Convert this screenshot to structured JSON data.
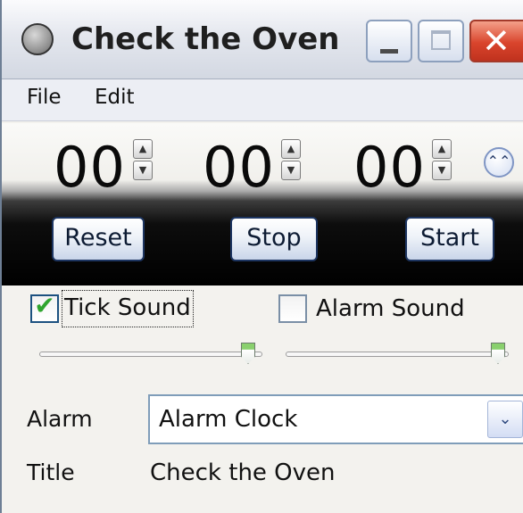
{
  "window": {
    "title": "Check the Oven",
    "icon": "clock-icon",
    "close_glyph": "✕"
  },
  "menu": {
    "items": [
      "File",
      "Edit"
    ]
  },
  "timer": {
    "hours": "00",
    "minutes": "00",
    "seconds": "00",
    "spin_up_glyph": "▲",
    "spin_down_glyph": "▼",
    "collapse_glyph": "⌃⌃"
  },
  "controls": {
    "reset_label": "Reset",
    "stop_label": "Stop",
    "start_label": "Start"
  },
  "sound": {
    "tick_label": "Tick Sound",
    "tick_checked": true,
    "tick_volume": 1.0,
    "alarm_label": "Alarm Sound",
    "alarm_checked": false,
    "alarm_volume": 1.0,
    "check_glyph": "✔"
  },
  "alarm": {
    "label": "Alarm",
    "value": "Alarm Clock",
    "dropdown_glyph": "⌄"
  },
  "title_row": {
    "label": "Title",
    "value": "Check the Oven"
  },
  "colors": {
    "accent_green": "#2fa52f",
    "close_red": "#d9442c",
    "button_border": "#1d3561"
  }
}
